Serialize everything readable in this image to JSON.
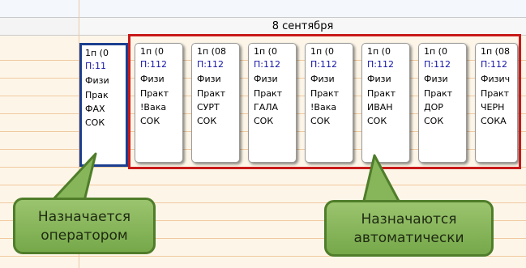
{
  "calendar": {
    "date_header": "8 сентября"
  },
  "manual_card": {
    "lines": [
      "1п (0",
      "П:11",
      "Физи",
      "Прак",
      "ФАХ",
      "СОК"
    ]
  },
  "auto_cards": [
    {
      "lines": [
        "1п (0",
        "П:112",
        "Физи",
        "Практ",
        "!Вака",
        "СОК"
      ]
    },
    {
      "lines": [
        "1п (08",
        "П:112",
        "Физи",
        "Практ",
        "СУРТ",
        "СОК"
      ]
    },
    {
      "lines": [
        "1п (0",
        "П:112",
        "Физи",
        "Практ",
        "ГАЛА",
        "СОК"
      ]
    },
    {
      "lines": [
        "1п (0",
        "П:112",
        "Физи",
        "Практ",
        "!Вака",
        "СОК"
      ]
    },
    {
      "lines": [
        "1п (0",
        "П:112",
        "Физи",
        "Практ",
        "ИВАН",
        "СОК"
      ]
    },
    {
      "lines": [
        "1п (0",
        "П:112",
        "Физи",
        "Практ",
        "ДОР",
        "СОК"
      ]
    },
    {
      "lines": [
        "1п (08",
        "П:112",
        "Физич",
        "Практ",
        "ЧЕРН",
        "СОКА"
      ]
    }
  ],
  "callouts": {
    "manual": "Назначается оператором",
    "automatic": "Назначаются автоматически"
  },
  "colors": {
    "manual_border": "#1b3f8f",
    "auto_highlight": "#c81a1a",
    "callout_fill": "#86b55a",
    "callout_border": "#4f7d2a",
    "line_blue": "#1515a8"
  }
}
